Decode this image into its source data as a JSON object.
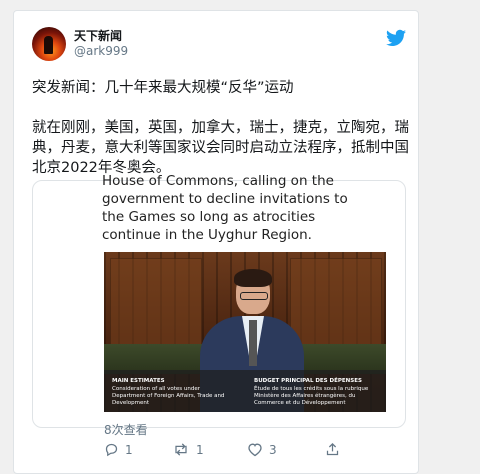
{
  "tweet": {
    "display_name": "天下新闻",
    "handle": "@ark999",
    "text_line1": "突发新闻：几十年来最大规模“反华”运动",
    "text_para2": "就在刚刚，美国，英国，加拿大，瑞士，捷克，立陶宛，瑞典，丹麦，意大利等国家议会同时启动立法程序，抵制中国北京2022年冬奥会。"
  },
  "embed": {
    "quoted_text": "House of Commons, calling on the government to decline invitations to the Games so long as atrocities continue in the Uyghur Region.",
    "video_caption_left_title": "MAIN ESTIMATES",
    "video_caption_left_body": "Consideration of all votes under Department of Foreign Affairs, Trade and Development",
    "video_caption_right_title": "BUDGET PRINCIPAL DES DÉPENSES",
    "video_caption_right_body": "Étude de tous les crédits sous la rubrique Ministère des Affaires étrangères, du Commerce et du Développement",
    "views": "8次查看"
  },
  "actions": {
    "reply_count": "1",
    "retweet_count": "1",
    "like_count": "3"
  },
  "colors": {
    "twitter_blue": "#1da1f2",
    "muted_text": "#657786"
  },
  "icons": [
    "twitter-bird-icon",
    "reply-icon",
    "retweet-icon",
    "like-icon",
    "share-icon"
  ]
}
